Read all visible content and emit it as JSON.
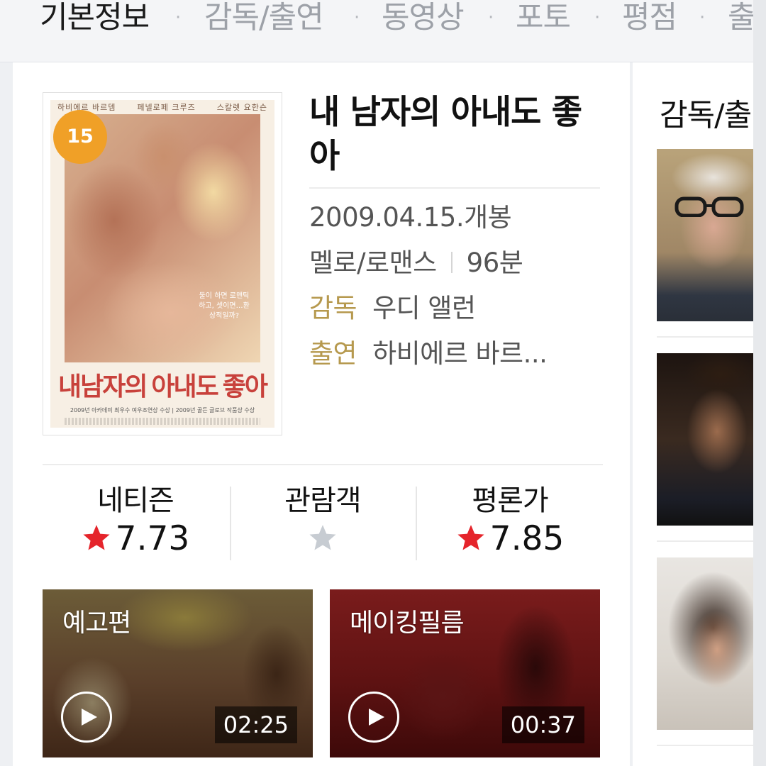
{
  "tabs": [
    {
      "label": "기본정보",
      "active": true
    },
    {
      "label": "감독/출연",
      "active": false
    },
    {
      "label": "동영상",
      "active": false
    },
    {
      "label": "포토",
      "active": false
    },
    {
      "label": "평점",
      "active": false
    },
    {
      "label": "출",
      "active": false
    }
  ],
  "tab_separator": "·",
  "movie": {
    "title": "내 남자의 아내도 좋아",
    "age_rating": "15",
    "release": "2009.04.15.개봉",
    "genre": "멜로/로맨스",
    "runtime": "96분",
    "director_key": "감독",
    "director": "우디 앨런",
    "cast_key": "출연",
    "cast": "하비에르 바르..."
  },
  "poster": {
    "title_text": "내남자의 아내도 좋아",
    "credits": [
      "하비에르 바르뎀",
      "페넬로페 크루즈",
      "스칼렛 요한슨"
    ],
    "tagline": "둘이 하면 로맨틱 하고, 셋이면…환상적일까?",
    "award_text": "2009년 아카데미 최우수 여우조연상 수상 | 2009년 골든 글로브 작품상 수상"
  },
  "ratings": [
    {
      "label": "네티즌",
      "value": "7.73",
      "has_score": true
    },
    {
      "label": "관람객",
      "value": "",
      "has_score": false
    },
    {
      "label": "평론가",
      "value": "7.85",
      "has_score": true
    }
  ],
  "videos": [
    {
      "label": "예고편",
      "duration": "02:25"
    },
    {
      "label": "메이킹필름",
      "duration": "00:37"
    }
  ],
  "side": {
    "title": "감독/출"
  },
  "colors": {
    "age_badge": "#f0a027",
    "star_active": "#e5242b",
    "star_inactive": "#c7ccd2",
    "info_key": "#b6994e"
  }
}
